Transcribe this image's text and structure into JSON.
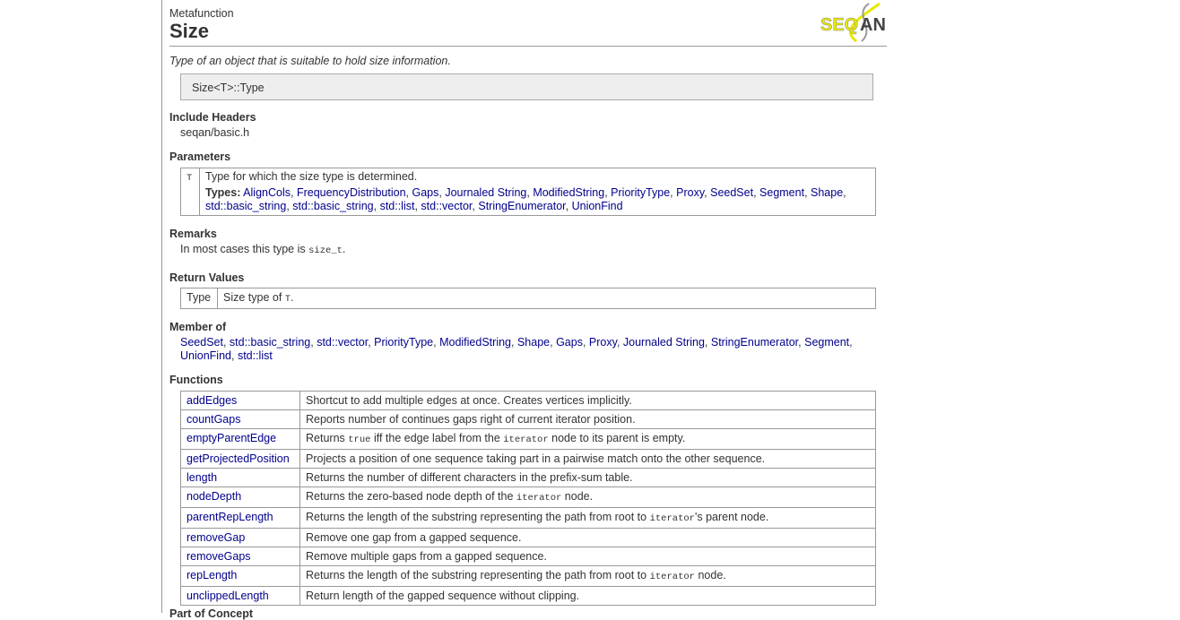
{
  "header": {
    "kind": "Metafunction",
    "title": "Size",
    "logo": "SEQAN"
  },
  "summary": "Type of an object that is suitable to hold size information.",
  "signature": "Size<T>::Type",
  "include": {
    "heading": "Include Headers",
    "value": "seqan/basic.h"
  },
  "parameters": {
    "heading": "Parameters",
    "name": "T",
    "desc": "Type for which the size type is determined.",
    "types_label": "Types:",
    "types": [
      "AlignCols",
      "FrequencyDistribution",
      "Gaps",
      "Journaled String",
      "ModifiedString",
      "PriorityType",
      "Proxy",
      "SeedSet",
      "Segment",
      "Shape",
      "std::basic_string",
      "std::basic_string",
      "std::list",
      "std::vector",
      "StringEnumerator",
      "UnionFind"
    ]
  },
  "remarks": {
    "heading": "Remarks",
    "text": "In most cases this type is ",
    "code": "size_t",
    "end": "."
  },
  "returns": {
    "heading": "Return Values",
    "type": "Type",
    "text": "Size type of ",
    "code": "T",
    "end": "."
  },
  "member_of": {
    "heading": "Member of",
    "items": [
      "SeedSet",
      "std::basic_string",
      "std::vector",
      "PriorityType",
      "ModifiedString",
      "Shape",
      "Gaps",
      "Proxy",
      "Journaled String",
      "StringEnumerator",
      "Segment",
      "UnionFind",
      "std::list"
    ]
  },
  "functions": {
    "heading": "Functions",
    "rows": [
      {
        "name": "addEdges",
        "desc": [
          [
            "Shortcut to add multiple edges at once. Creates vertices implicitly.",
            0
          ]
        ]
      },
      {
        "name": "countGaps",
        "desc": [
          [
            "Reports number of continues gaps right of current iterator position.",
            0
          ]
        ]
      },
      {
        "name": "emptyParentEdge",
        "desc": [
          [
            "Returns ",
            0
          ],
          [
            "true",
            1
          ],
          [
            " iff the edge label from the ",
            0
          ],
          [
            "iterator",
            1
          ],
          [
            " node to its parent is empty.",
            0
          ]
        ]
      },
      {
        "name": "getProjectedPosition",
        "desc": [
          [
            "Projects a position of one sequence taking part in a pairwise match onto the other sequence.",
            0
          ]
        ]
      },
      {
        "name": "length",
        "desc": [
          [
            "Returns the number of different characters in the prefix-sum table.",
            0
          ]
        ]
      },
      {
        "name": "nodeDepth",
        "desc": [
          [
            "Returns the zero-based node depth of the ",
            0
          ],
          [
            "iterator",
            1
          ],
          [
            " node.",
            0
          ]
        ]
      },
      {
        "name": "parentRepLength",
        "desc": [
          [
            "Returns the length of the substring representing the path from root to ",
            0
          ],
          [
            "iterator",
            1
          ],
          [
            "'s parent node.",
            0
          ]
        ]
      },
      {
        "name": "removeGap",
        "desc": [
          [
            "Remove one gap from a gapped sequence.",
            0
          ]
        ]
      },
      {
        "name": "removeGaps",
        "desc": [
          [
            "Remove multiple gaps from a gapped sequence.",
            0
          ]
        ]
      },
      {
        "name": "repLength",
        "desc": [
          [
            "Returns the length of the substring representing the path from root to ",
            0
          ],
          [
            "iterator",
            1
          ],
          [
            " node.",
            0
          ]
        ]
      },
      {
        "name": "unclippedLength",
        "desc": [
          [
            "Return length of the gapped sequence without clipping.",
            0
          ]
        ]
      }
    ]
  },
  "next_heading": "Part of Concept"
}
